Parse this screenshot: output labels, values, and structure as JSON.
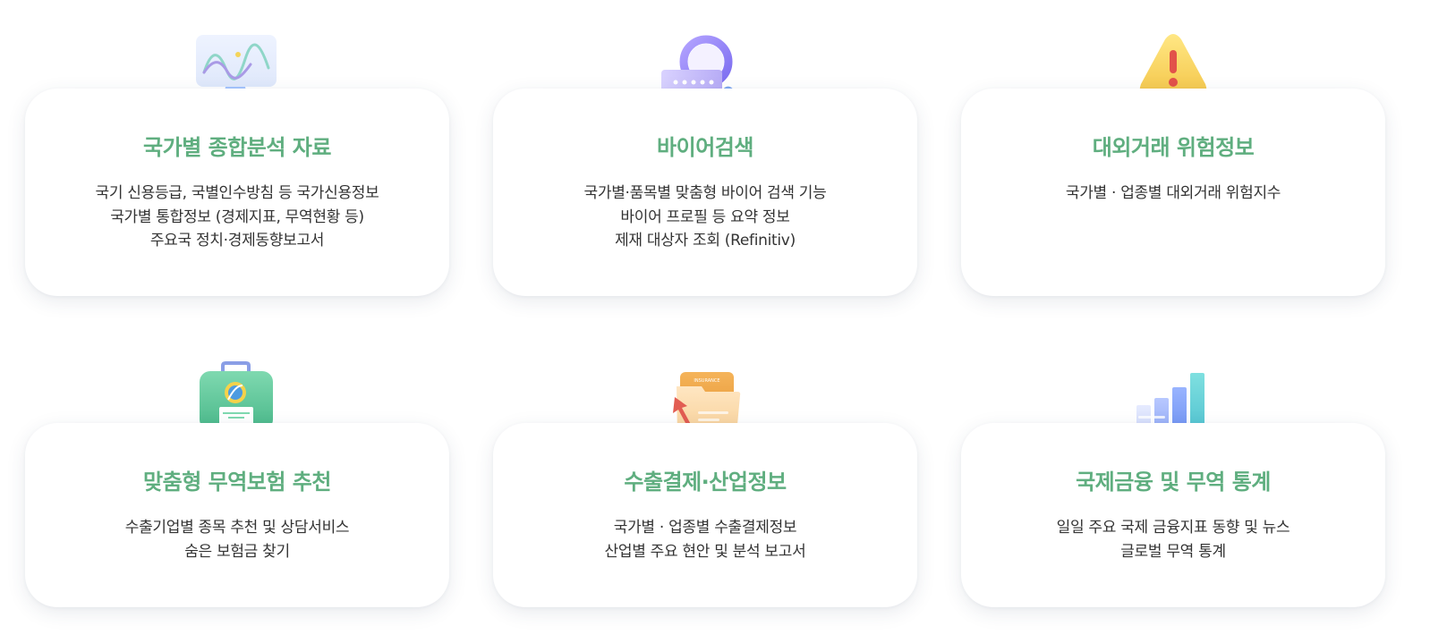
{
  "cards": [
    {
      "icon": "chart-monitor-icon",
      "title": "국가별 종합분석 자료",
      "lines": [
        "국기 신용등급, 국별인수방침 등 국가신용정보",
        "국가별 통합정보 (경제지표, 무역현황 등)",
        "주요국 정치·경제동향보고서"
      ]
    },
    {
      "icon": "magnifier-search-icon",
      "title": "바이어검색",
      "lines": [
        "국가별·품목별 맞춤형 바이어 검색 기능",
        "바이어 프로필 등 요약 정보",
        "제재 대상자 조회 (Refinitiv)"
      ]
    },
    {
      "icon": "warning-triangle-icon",
      "title": "대외거래 위험정보",
      "lines": [
        "국가별 · 업종별 대외거래 위험지수"
      ]
    },
    {
      "icon": "insurance-briefcase-icon",
      "title": "맞춤형 무역보험 추천",
      "lines": [
        "수출기업별 종목 추천 및 상담서비스",
        "숨은 보험금 찾기"
      ]
    },
    {
      "icon": "insurance-folder-arrow-icon",
      "title": "수출결제·산업정보",
      "lines": [
        "국가별 · 업종별 수출결제정보",
        "산업별 주요 현안 및 분석 보고서"
      ]
    },
    {
      "icon": "bar-chart-icon",
      "title": "국제금융 및 무역 통계",
      "lines": [
        "일일 주요 국제 금융지표 동향 및 뉴스",
        "글로벌 무역 통계"
      ]
    }
  ],
  "icon_labels": {
    "folder_tab": "INSURANCE"
  },
  "colors": {
    "title": "#5fae7f",
    "text": "#333333",
    "card_bg": "#ffffff"
  }
}
